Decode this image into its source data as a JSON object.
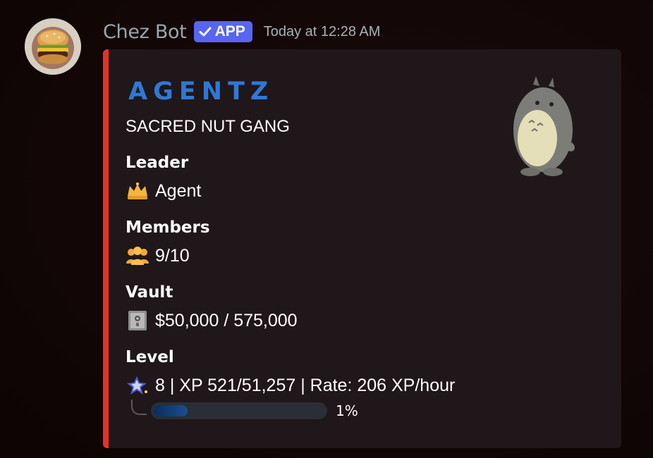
{
  "message": {
    "author": "Chez Bot",
    "app_badge": "APP",
    "timestamp": "Today at 12:28 AM"
  },
  "embed": {
    "accent_color": "#e53226",
    "logo_text": "AGENTZ",
    "subtitle": "SACRED NUT GANG",
    "fields": {
      "leader": {
        "name": "Leader",
        "value": "Agent",
        "icon": "crown-icon"
      },
      "members": {
        "name": "Members",
        "value": "9/10",
        "icon": "people-icon"
      },
      "vault": {
        "name": "Vault",
        "value": "$50,000 / 575,000",
        "icon": "safe-icon"
      },
      "level": {
        "name": "Level",
        "value": "8 | XP 521/51,257 | Rate: 206 XP/hour",
        "icon": "star-icon"
      }
    },
    "progress": {
      "percent_label": "1%",
      "fraction": 0.01
    },
    "thumbnail": "totoro-icon"
  }
}
